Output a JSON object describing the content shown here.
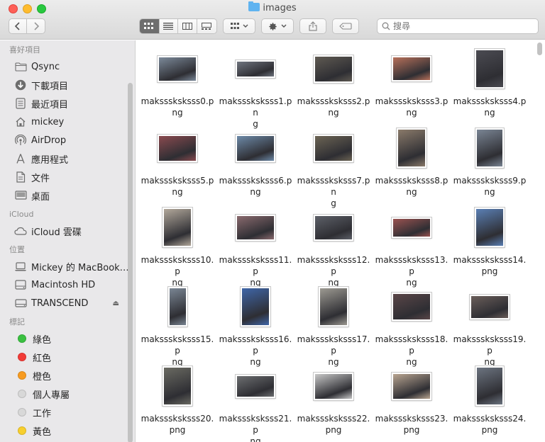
{
  "window": {
    "title": "images"
  },
  "search": {
    "placeholder": "搜尋"
  },
  "sidebar": {
    "sections": [
      {
        "title": "喜好項目",
        "items": [
          {
            "label": "Qsync",
            "icon": "folder-icon"
          },
          {
            "label": "下載項目",
            "icon": "download-icon"
          },
          {
            "label": "最近項目",
            "icon": "recents-icon"
          },
          {
            "label": "mickey",
            "icon": "home-icon"
          },
          {
            "label": "AirDrop",
            "icon": "airdrop-icon"
          },
          {
            "label": "應用程式",
            "icon": "applications-icon"
          },
          {
            "label": "文件",
            "icon": "document-icon"
          },
          {
            "label": "桌面",
            "icon": "desktop-icon"
          }
        ]
      },
      {
        "title": "iCloud",
        "items": [
          {
            "label": "iCloud 雲碟",
            "icon": "cloud-icon"
          }
        ]
      },
      {
        "title": "位置",
        "items": [
          {
            "label": "Mickey 的 MacBook…",
            "icon": "laptop-icon"
          },
          {
            "label": "Macintosh HD",
            "icon": "disk-icon"
          },
          {
            "label": "TRANSCEND",
            "icon": "drive-icon",
            "eject": "⏏"
          }
        ]
      },
      {
        "title": "標記",
        "items": [
          {
            "label": "綠色",
            "color": "#3ac041"
          },
          {
            "label": "紅色",
            "color": "#f23b37"
          },
          {
            "label": "橙色",
            "color": "#f79b20"
          },
          {
            "label": "個人專屬",
            "color": "#d8d8d8"
          },
          {
            "label": "工作",
            "color": "#d8d8d8"
          },
          {
            "label": "黃色",
            "color": "#f7cf2e"
          }
        ]
      }
    ]
  },
  "files": [
    {
      "line1": "maksssksksss0.p",
      "line2": "ng",
      "color": "#7c8a9a",
      "ar": 1.5
    },
    {
      "line1": "maksssksksss1.pn",
      "line2": "g",
      "color": "#6f747e",
      "ar": 2.2
    },
    {
      "line1": "maksssksksss2.p",
      "line2": "ng",
      "color": "#5f5a52",
      "ar": 1.45
    },
    {
      "line1": "maksssksksss3.p",
      "line2": "ng",
      "color": "#b7705a",
      "ar": 1.55
    },
    {
      "line1": "maksssksksss4.p",
      "line2": "ng",
      "color": "#4b4b52",
      "ar": 0.75
    },
    {
      "line1": "maksssksksss5.p",
      "line2": "ng",
      "color": "#8a4a4f",
      "ar": 1.45
    },
    {
      "line1": "maksssksksss6.p",
      "line2": "ng",
      "color": "#6d8aa8",
      "ar": 1.45
    },
    {
      "line1": "maksssksksss7.pn",
      "line2": "g",
      "color": "#6c6454",
      "ar": 1.45
    },
    {
      "line1": "maksssksksss8.p",
      "line2": "ng",
      "color": "#8a7a6a",
      "ar": 0.75
    },
    {
      "line1": "maksssksksss9.p",
      "line2": "ng",
      "color": "#7a8594",
      "ar": 0.72
    },
    {
      "line1": "maksssksksss10.p",
      "line2": "ng",
      "color": "#b2a89b",
      "ar": 0.75
    },
    {
      "line1": "maksssksksss11.p",
      "line2": "ng",
      "color": "#8a6a6e",
      "ar": 1.5
    },
    {
      "line1": "maksssksksss12.p",
      "line2": "ng",
      "color": "#5d6068",
      "ar": 1.5
    },
    {
      "line1": "maksssksksss13.p",
      "line2": "ng",
      "color": "#9a5250",
      "ar": 1.9
    },
    {
      "line1": "maksssksksss14.",
      "line2": "png",
      "color": "#5a7fb4",
      "ar": 0.75
    },
    {
      "line1": "maksssksksss15.p",
      "line2": "ng",
      "color": "#7a8694",
      "ar": 0.48
    },
    {
      "line1": "maksssksksss16.p",
      "line2": "ng",
      "color": "#3f66a8",
      "ar": 0.75
    },
    {
      "line1": "maksssksksss17.p",
      "line2": "ng",
      "color": "#9d9a92",
      "ar": 0.75
    },
    {
      "line1": "maksssksksss18.p",
      "line2": "ng",
      "color": "#5a4648",
      "ar": 1.4
    },
    {
      "line1": "maksssksksss19.p",
      "line2": "ng",
      "color": "#6a5e5a",
      "ar": 1.6
    },
    {
      "line1": "maksssksksss20.",
      "line2": "png",
      "color": "#6a6a62",
      "ar": 0.75
    },
    {
      "line1": "maksssksksss21.p",
      "line2": "ng",
      "color": "#6c6e70",
      "ar": 1.7
    },
    {
      "line1": "maksssksksss22.",
      "line2": "png",
      "color": "#c8c8c8",
      "ar": 1.45
    },
    {
      "line1": "maksssksksss23.",
      "line2": "png",
      "color": "#b9a591",
      "ar": 1.45
    },
    {
      "line1": "maksssksksss24.",
      "line2": "png",
      "color": "#6c7480",
      "ar": 0.72
    }
  ]
}
